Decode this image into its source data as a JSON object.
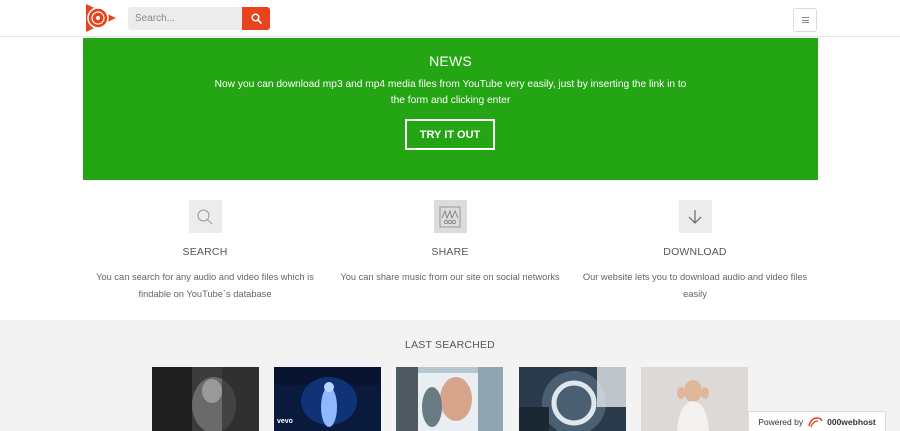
{
  "header": {
    "logo_icon": "play-disc-logo-icon",
    "search": {
      "placeholder": "Search..."
    },
    "search_button_icon": "search-icon",
    "menu_icon": "hamburger-icon",
    "accent_color": "#e8431c"
  },
  "news": {
    "title": "NEWS",
    "text": "Now you can download mp3 and mp4 media files from YouTube very easily, just by inserting the link in to the form and clicking enter",
    "button_label": "TRY IT OUT",
    "background_color": "#24a514"
  },
  "features": [
    {
      "icon": "search-icon",
      "title": "SEARCH",
      "description": "You can search for any audio and video files which is findable on YouTube`s database"
    },
    {
      "icon": "share-icon",
      "title": "SHARE",
      "description": "You can share music from our site on social networks"
    },
    {
      "icon": "download-arrow-icon",
      "title": "DOWNLOAD",
      "description": "Our website lets you to download audio and video files easily"
    }
  ],
  "last_searched": {
    "title": "LAST SEARCHED",
    "thumbnails": [
      {
        "overlay_text": ""
      },
      {
        "overlay_text": "vevo"
      },
      {
        "overlay_text": ""
      },
      {
        "overlay_text": ""
      },
      {
        "overlay_text": ""
      }
    ]
  },
  "footer_badge": {
    "prefix": "Powered by",
    "brand": "000webhost",
    "icon": "000webhost-logo-icon"
  }
}
